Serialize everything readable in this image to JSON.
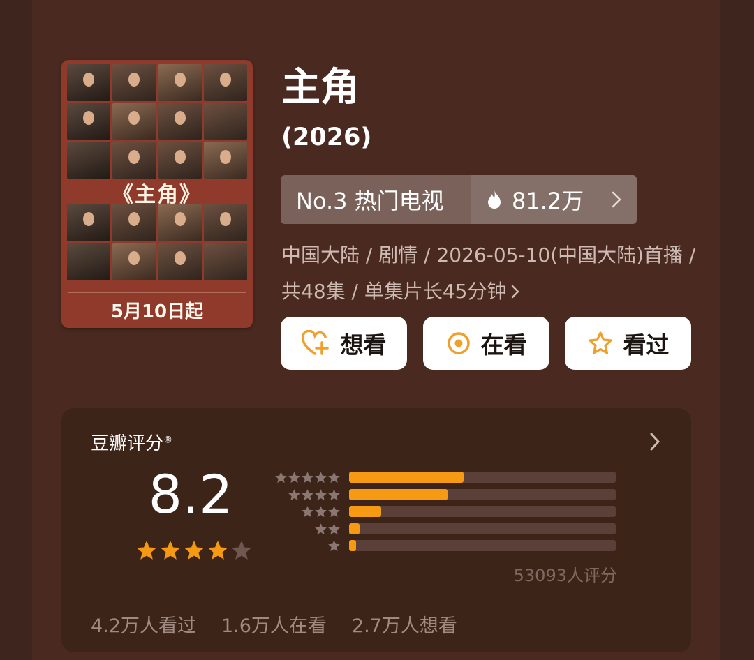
{
  "poster": {
    "title_text": "《主角》",
    "date_text": "5月10日起"
  },
  "title": "主角",
  "year": "(2026)",
  "rank": {
    "label": "No.3 热门电视",
    "heat": "81.2万",
    "flame_icon": "flame-icon",
    "chevron_icon": "chevron-right-icon"
  },
  "meta": {
    "line": "中国大陆 / 剧情 / 2026-05-10(中国大陆)首播 / 共48集 / 单集片长45分钟"
  },
  "actions": [
    {
      "label": "想看",
      "icon": "heart-plus-icon"
    },
    {
      "label": "在看",
      "icon": "target-icon"
    },
    {
      "label": "看过",
      "icon": "star-outline-icon"
    }
  ],
  "rating": {
    "source_label": "豆瓣评分",
    "registered_mark": "®",
    "score": "8.2",
    "stars_filled": 4,
    "stars_total": 5,
    "distribution": [
      {
        "stars": 5,
        "fraction": 0.43
      },
      {
        "stars": 4,
        "fraction": 0.37
      },
      {
        "stars": 3,
        "fraction": 0.12
      },
      {
        "stars": 2,
        "fraction": 0.04
      },
      {
        "stars": 1,
        "fraction": 0.025
      }
    ],
    "count_text": "53093人评分",
    "watched": "4.2万人看过",
    "watching": "1.6万人在看",
    "wanted": "2.7万人想看"
  },
  "colors": {
    "accent": "#f59a12",
    "background": "#4a2a20",
    "panel": "#3d2419"
  }
}
